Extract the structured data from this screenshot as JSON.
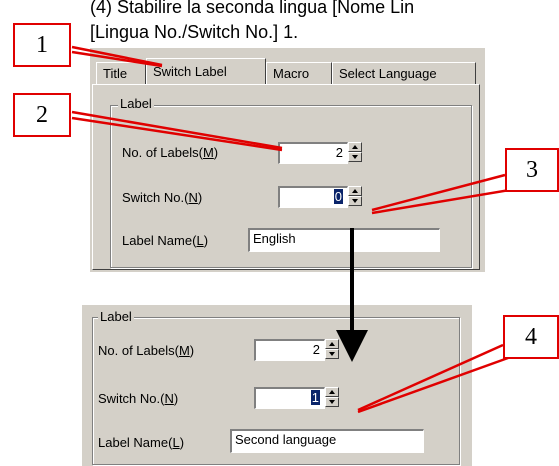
{
  "caption": {
    "line1": "(4) Stabilire la seconda lingua [Nome Lin",
    "line2": "[Lingua No./Switch No.] 1."
  },
  "tabs": [
    {
      "label": "Title",
      "active": false
    },
    {
      "label": "Switch Label",
      "active": true
    },
    {
      "label": "Macro",
      "active": false
    },
    {
      "label": "Select Language",
      "active": false
    }
  ],
  "before": {
    "group_title": "Label",
    "labels_count": {
      "label": "No. of Labels",
      "mnemonic": "M",
      "value": "2"
    },
    "switch_no": {
      "label": "Switch No.",
      "mnemonic": "N",
      "value": "0"
    },
    "label_name": {
      "label": "Label Name",
      "mnemonic": "L",
      "value": "English"
    }
  },
  "after": {
    "group_title": "Label",
    "labels_count": {
      "label": "No. of Labels",
      "mnemonic": "M",
      "value": "2"
    },
    "switch_no": {
      "label": "Switch No.",
      "mnemonic": "N",
      "value": "1"
    },
    "label_name": {
      "label": "Label Name",
      "mnemonic": "L",
      "value": "Second language"
    }
  },
  "callouts": [
    "1",
    "2",
    "3",
    "4"
  ],
  "colors": {
    "callout_border": "#e00000",
    "dialog_face": "#d4d0c8",
    "selection": "#0a246a"
  }
}
